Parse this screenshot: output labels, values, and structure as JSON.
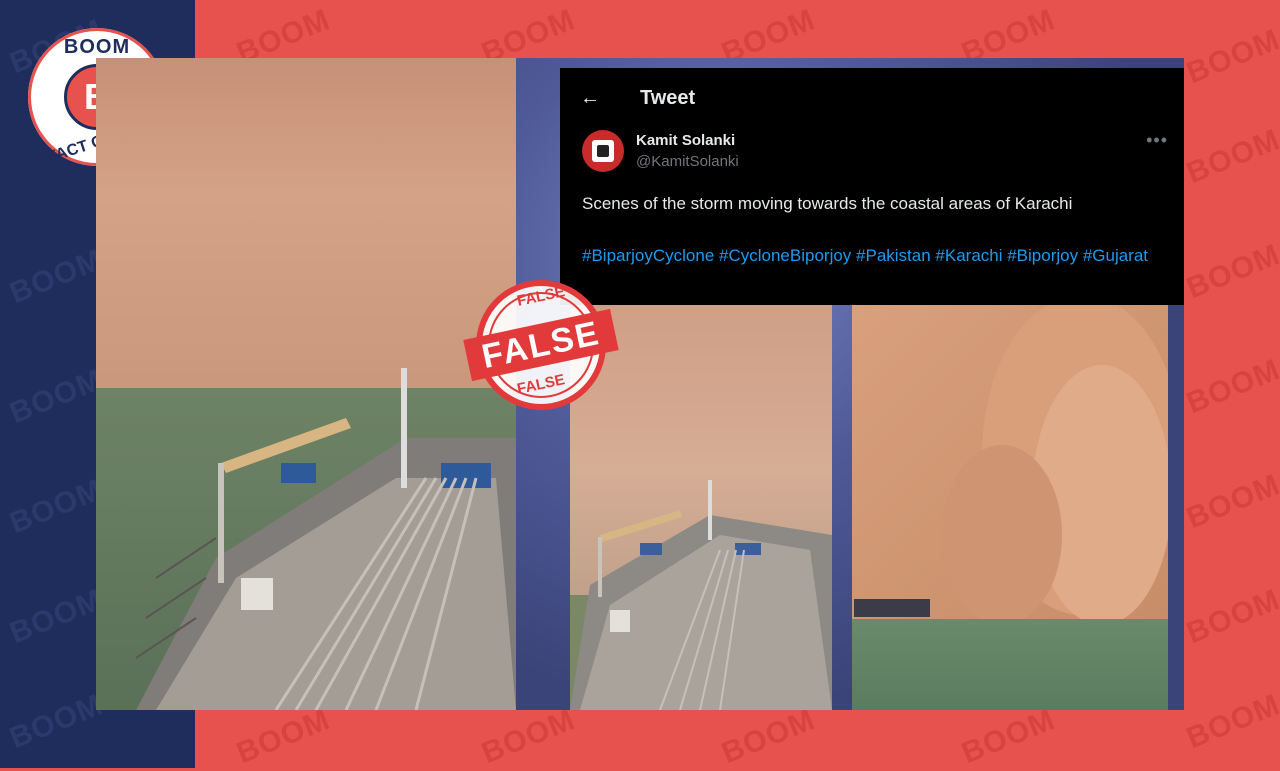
{
  "brand": {
    "logo_top": "BOOM",
    "logo_letter": "B",
    "logo_bottom": "FACT CHECK",
    "watermark": "BOOM"
  },
  "stamp": {
    "top": "FALSE",
    "center": "FALSE",
    "bottom": "FALSE"
  },
  "tweet": {
    "header_title": "Tweet",
    "user_name": "Kamit Solanki",
    "user_handle": "@KamitSolanki",
    "text": "Scenes of the storm moving towards the coastal areas of Karachi",
    "hashtags": "#BiparjoyCyclone #CycloneBiporjoy #Pakistan #Karachi #Biporjoy #Gujarat"
  },
  "colors": {
    "brand_red": "#e8524e",
    "brand_navy": "#1e2d5c",
    "link_blue": "#1d9bf0",
    "stamp_red": "#e23a3a"
  },
  "icons": [
    "back-arrow-icon",
    "more-icon",
    "avatar"
  ]
}
